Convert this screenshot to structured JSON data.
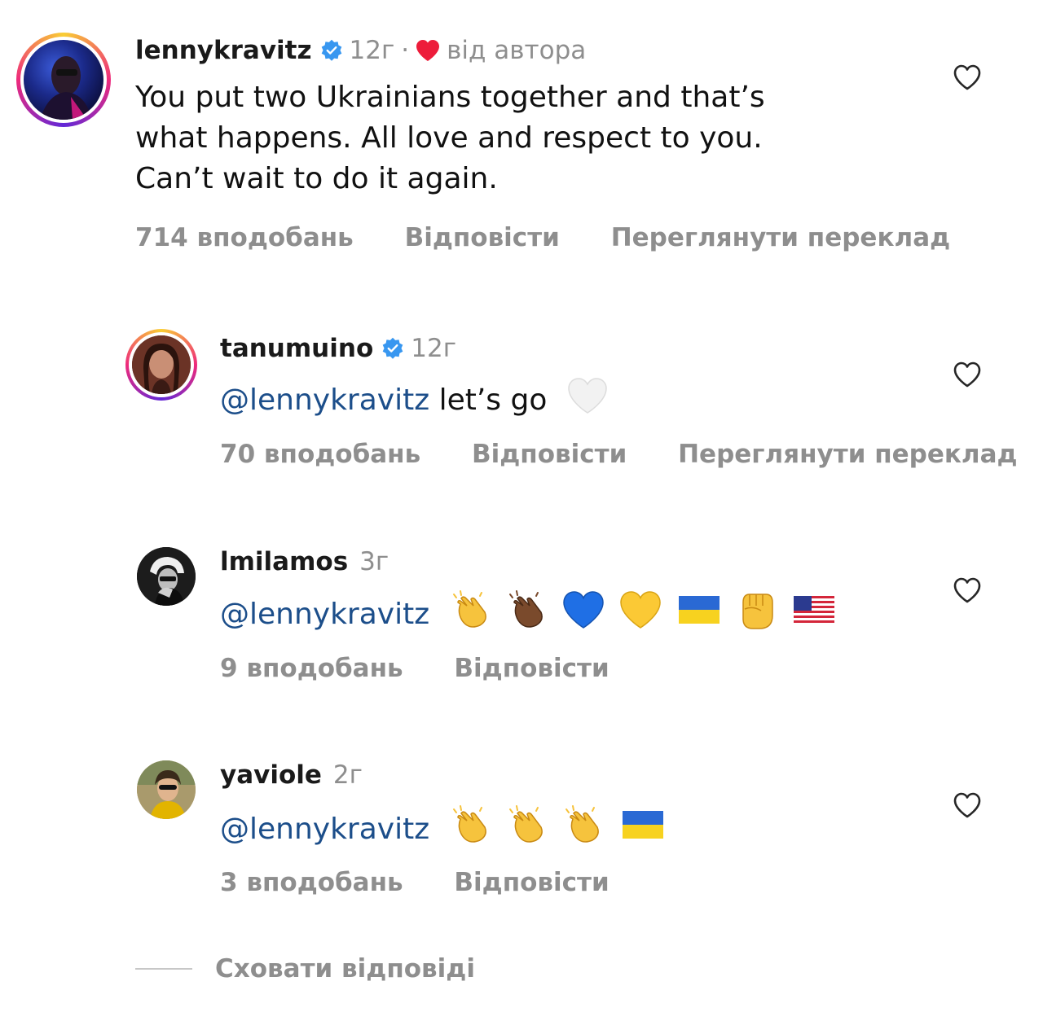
{
  "comments": [
    {
      "username": "lennykravitz",
      "verified": true,
      "time": "12г",
      "separator": "·",
      "author_liked_label": "від автора",
      "text_lines": [
        "You put two Ukrainians together and that’s",
        "what happens. All love and respect to you.",
        "Can’t wait to do it again."
      ],
      "likes": "714 вподобань",
      "reply": "Відповісти",
      "translate": "Переглянути переклад"
    },
    {
      "username": "tanumuino",
      "verified": true,
      "time": "12г",
      "mention": "@lennykravitz",
      "text": " let’s go",
      "emojis": [
        "white-heart"
      ],
      "likes": "70 вподобань",
      "reply": "Відповісти",
      "translate": "Переглянути переклад"
    },
    {
      "username": "lmilamos",
      "verified": false,
      "time": "3г",
      "mention": "@lennykravitz",
      "emojis": [
        "clapping-hands",
        "clapping-hands-dark",
        "blue-heart",
        "yellow-heart",
        "ukraine-flag",
        "raised-fist",
        "us-flag"
      ],
      "likes": "9 вподобань",
      "reply": "Відповісти"
    },
    {
      "username": "yaviole",
      "verified": false,
      "time": "2г",
      "mention": "@lennykravitz",
      "emojis": [
        "clapping-hands",
        "clapping-hands",
        "clapping-hands",
        "ukraine-flag"
      ],
      "likes": "3 вподобань",
      "reply": "Відповісти"
    }
  ],
  "hide_replies": "Сховати відповіді",
  "colors": {
    "muted": "#8e8e8e",
    "mention": "#1c4e8a",
    "verified": "#3897f0",
    "author_heart": "#ed1c3a"
  }
}
